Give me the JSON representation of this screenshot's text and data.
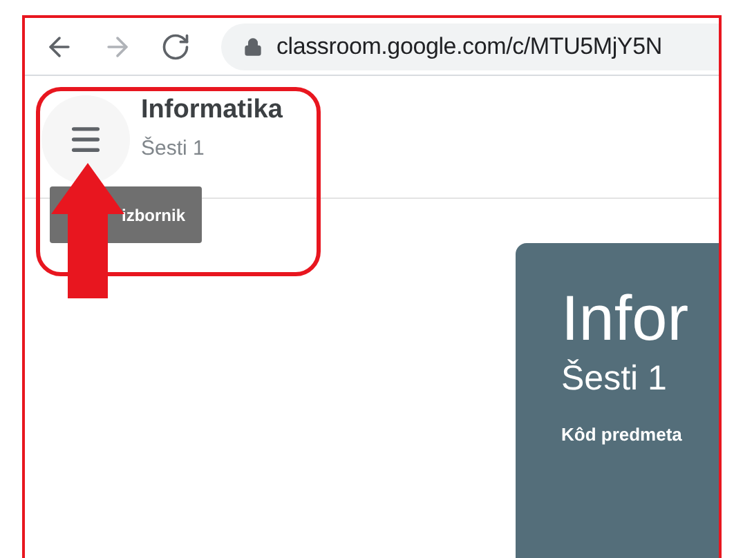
{
  "browser": {
    "url": "classroom.google.com/c/MTU5MjY5N"
  },
  "header": {
    "class_name": "Informatika",
    "section": "Šesti 1"
  },
  "tooltip": {
    "text": "izbornik"
  },
  "banner": {
    "title": "Infor",
    "section": "Šesti 1",
    "class_code_label": "Kôd predmeta"
  }
}
